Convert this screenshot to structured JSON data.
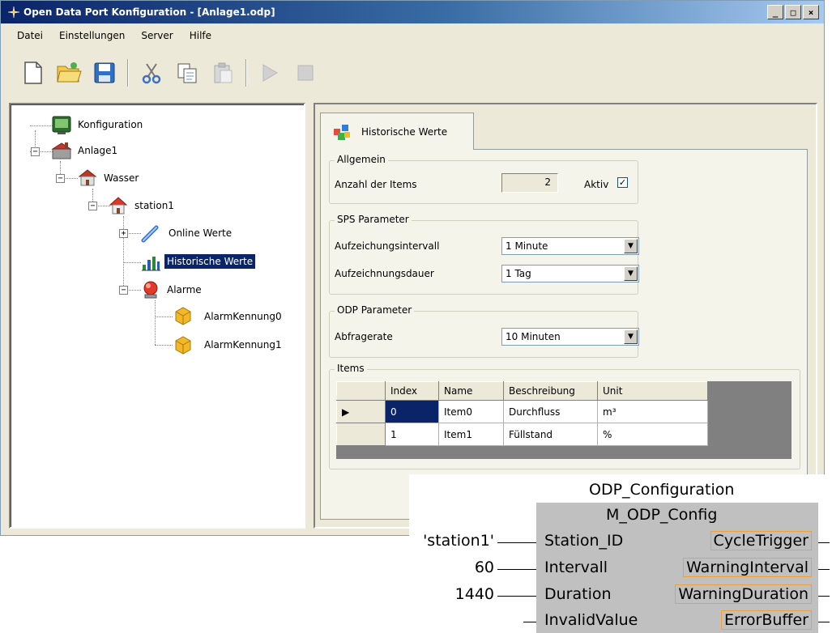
{
  "window": {
    "title": "Open Data Port Konfiguration - [Anlage1.odp]",
    "controls": [
      "_",
      "□",
      "×"
    ]
  },
  "menu": {
    "items": [
      "Datei",
      "Einstellungen",
      "Server",
      "Hilfe"
    ]
  },
  "toolbar": {
    "buttons": [
      "new-document-icon",
      "open-folder-icon",
      "save-icon",
      "cut-icon",
      "copy-icon",
      "paste-icon",
      "play-icon",
      "stop-icon"
    ]
  },
  "tree": {
    "nodes": [
      {
        "label": "Konfiguration",
        "icon": "configuration-icon"
      },
      {
        "label": "Anlage1",
        "icon": "plant-icon",
        "expander": "−"
      },
      {
        "label": "Wasser",
        "icon": "water-icon",
        "expander": "−"
      },
      {
        "label": "station1",
        "icon": "station-icon",
        "expander": "−"
      },
      {
        "label": "Online Werte",
        "icon": "online-values-icon",
        "expander": "+"
      },
      {
        "label": "Historische Werte",
        "icon": "historical-values-icon",
        "selected": true
      },
      {
        "label": "Alarme",
        "icon": "alarm-icon",
        "expander": "−"
      },
      {
        "label": "AlarmKennung0",
        "icon": "alarm-item-icon"
      },
      {
        "label": "AlarmKennung1",
        "icon": "alarm-item-icon"
      }
    ]
  },
  "tab": {
    "label": "Historische Werte"
  },
  "general": {
    "legend": "Allgemein",
    "items_label": "Anzahl der Items",
    "items_count": "2",
    "active_label": "Aktiv",
    "active_checked": "✓"
  },
  "sps": {
    "legend": "SPS Parameter",
    "interval_label": "Aufzeichungsintervall",
    "interval_value": "1 Minute",
    "duration_label": "Aufzeichnungsdauer",
    "duration_value": "1 Tag"
  },
  "odp": {
    "legend": "ODP Parameter",
    "rate_label": "Abfragerate",
    "rate_value": "10 Minuten"
  },
  "items": {
    "legend": "Items",
    "columns": [
      "Index",
      "Name",
      "Beschreibung",
      "Unit"
    ],
    "rows": [
      {
        "marker": "▶",
        "index": "0",
        "name": "Item0",
        "description": "Durchfluss",
        "unit": "m³"
      },
      {
        "marker": "",
        "index": "1",
        "name": "Item1",
        "description": "Füllstand",
        "unit": "%"
      }
    ]
  },
  "function_block": {
    "instance": "ODP_Configuration",
    "type": "M_ODP_Config",
    "inputs": [
      {
        "value": "'station1'",
        "name": "Station_ID"
      },
      {
        "value": "60",
        "name": "Intervall"
      },
      {
        "value": "1440",
        "name": "Duration"
      },
      {
        "value": "",
        "name": "InvalidValue"
      }
    ],
    "outputs": [
      "CycleTrigger",
      "WarningInterval",
      "WarningDuration",
      "ErrorBuffer"
    ]
  },
  "colors": {
    "titlebar": "#0a246a",
    "selection": "#0a246a",
    "block": "#c0c0c0",
    "output_border": "#e8a040"
  }
}
